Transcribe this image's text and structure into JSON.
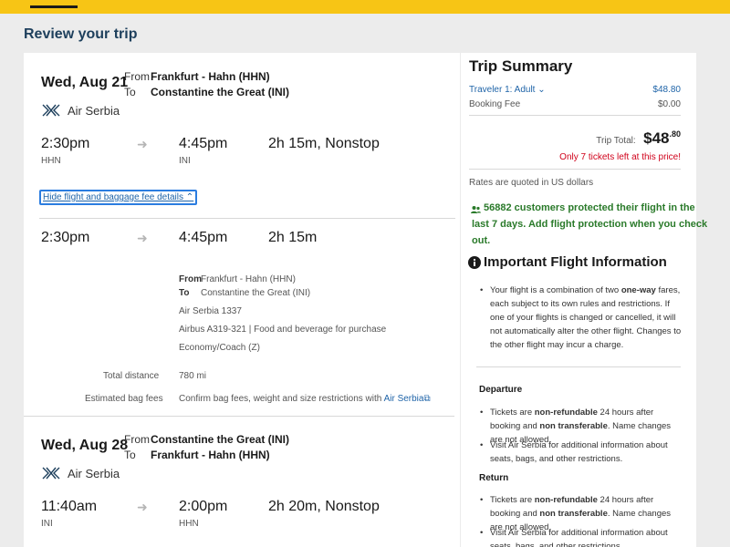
{
  "header": {
    "title": "Review your trip"
  },
  "outbound": {
    "date": "Wed, Aug 21",
    "from_label": "From",
    "to_label": "To",
    "from_airport": "Frankfurt - Hahn (HHN)",
    "to_airport": "Constantine the Great (INI)",
    "airline": "Air Serbia",
    "depart_time": "2:30pm",
    "depart_code": "HHN",
    "arrive_time": "4:45pm",
    "arrive_code": "INI",
    "duration": "2h 15m, Nonstop",
    "hide_link": "Hide flight and baggage fee details"
  },
  "details": {
    "depart_time": "2:30pm",
    "arrive_time": "4:45pm",
    "duration": "2h 15m",
    "from_label": "From",
    "to_label": "To",
    "from_airport": "Frankfurt - Hahn (HHN)",
    "to_airport": "Constantine the Great (INI)",
    "flight": "Air Serbia 1337",
    "aircraft": "Airbus A319-321 | Food and beverage for purchase",
    "cabin": "Economy/Coach (Z)",
    "distance_label": "Total distance",
    "distance_value": "780 mi",
    "bag_label": "Estimated bag fees",
    "bag_text": "Confirm bag fees, weight and size restrictions with",
    "bag_link": "Air Serbia"
  },
  "return": {
    "date": "Wed, Aug 28",
    "from_label": "From",
    "to_label": "To",
    "from_airport": "Constantine the Great (INI)",
    "to_airport": "Frankfurt - Hahn (HHN)",
    "airline": "Air Serbia",
    "depart_time": "11:40am",
    "depart_code": "INI",
    "arrive_time": "2:00pm",
    "arrive_code": "HHN",
    "duration": "2h 20m, Nonstop"
  },
  "summary": {
    "title": "Trip Summary",
    "traveler_label": "Traveler 1: Adult",
    "traveler_price": "$48.80",
    "fee_label": "Booking Fee",
    "fee_value": "$0.00",
    "total_label": "Trip Total:",
    "total_dollars": "$48",
    "total_cents": ".80",
    "tickets_left": "Only 7 tickets left at this price!",
    "currency_note": "Rates are quoted in US dollars",
    "protect_line1": "56882 customers protected their flight in the",
    "protect_line2": "last 7 days. Add flight protection when you check",
    "protect_line3": "out.",
    "info_title": "Important Flight Information",
    "info_bullet_a": "Your flight is a combination of two",
    "info_bullet_b": "one-way",
    "info_bullet_c": "fares, each subject to its own rules and restrictions. If one of your flights is changed or cancelled, it will not automatically alter the other flight. Changes to the other flight may incur a charge.",
    "departure_title": "Departure",
    "dep_b1_a": "Tickets are",
    "dep_b1_b": "non-refundable",
    "dep_b1_c": "24 hours after booking and",
    "dep_b1_d": "non transferable",
    "dep_b1_e": ". Name changes are not allowed.",
    "dep_b2": "Visit Air Serbia for additional information about seats, bags, and other restrictions.",
    "return_title": "Return",
    "ret_b1_a": "Tickets are",
    "ret_b1_b": "non-refundable",
    "ret_b1_c": "24 hours after booking and",
    "ret_b1_d": "non transferable",
    "ret_b1_e": ". Name changes are not allowed.",
    "ret_b2": "Visit Air Serbia for additional information about seats, bags, and other restrictions."
  },
  "colors": {
    "brand_yellow": "#f7c515",
    "link_blue": "#1f64a8",
    "price_red": "#d0021b",
    "protect_green": "#2a7a2a",
    "title_navy": "#1d3f5c"
  },
  "icons": {
    "airline_logo": "air-serbia-logo",
    "arrow": "arrow-right-icon",
    "shield": "shield-users-icon",
    "info": "info-icon",
    "chevron": "chevron-down-icon",
    "external": "external-link-icon"
  }
}
